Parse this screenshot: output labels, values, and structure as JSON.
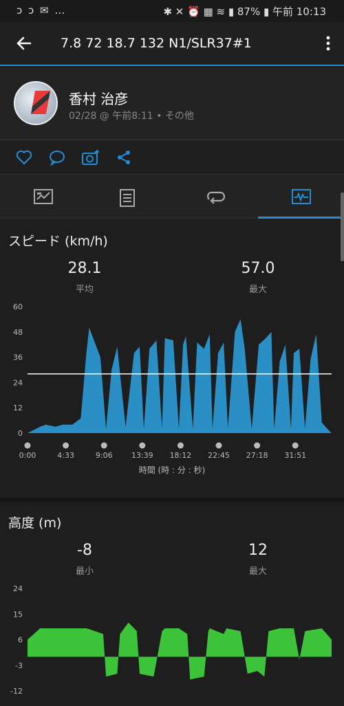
{
  "status": {
    "left_icons": "ↄ ↄ ✉ …",
    "right_text": "✱ ✕ ⏰ ▦ ≋ ▮ 87% ▮ 午前 10:13"
  },
  "appbar": {
    "title": "7.8  72  18.7  132  N1/SLR37#1"
  },
  "profile": {
    "name": "香村 治彦",
    "meta": "02/28 @ 午前8:11 • その他"
  },
  "speed": {
    "title": "スピード (km/h)",
    "avg_value": "28.1",
    "avg_label": "平均",
    "max_value": "57.0",
    "max_label": "最大",
    "x_axis_label": "時間 (時 : 分 : 秒)"
  },
  "altitude": {
    "title": "高度 (m)",
    "min_value": "-8",
    "min_label": "最小",
    "max_value": "12",
    "max_label": "最大"
  },
  "colors": {
    "accent": "#1f8fd8",
    "speed_fill": "#2a8fc4",
    "altitude_fill": "#3ec43a"
  },
  "chart_data": [
    {
      "type": "area",
      "title": "スピード (km/h)",
      "xlabel": "時間 (時 : 分 : 秒)",
      "ylabel": "",
      "ylim": [
        0,
        60
      ],
      "yticks": [
        "60",
        "48",
        "36",
        "24",
        "12",
        "0"
      ],
      "xticks": [
        "0:00",
        "4:33",
        "9:06",
        "13:39",
        "18:12",
        "22:45",
        "27:18",
        "31:51"
      ],
      "xlim": [
        0,
        2170
      ],
      "average_line": 28.1,
      "x": [
        0,
        90,
        130,
        200,
        250,
        320,
        380,
        420,
        440,
        520,
        560,
        600,
        640,
        700,
        760,
        800,
        830,
        870,
        920,
        960,
        980,
        1040,
        1080,
        1110,
        1130,
        1180,
        1210,
        1260,
        1300,
        1320,
        1360,
        1400,
        1430,
        1480,
        1520,
        1550,
        1600,
        1650,
        1700,
        1740,
        1760,
        1800,
        1840,
        1880,
        1900,
        1940,
        1980,
        2020,
        2060,
        2100,
        2140,
        2170
      ],
      "y": [
        0,
        3,
        4,
        3,
        4,
        4,
        7,
        38,
        50,
        36,
        2,
        30,
        41,
        3,
        38,
        41,
        2,
        40,
        44,
        2,
        45,
        44,
        2,
        42,
        46,
        2,
        43,
        40,
        47,
        2,
        38,
        43,
        2,
        48,
        54,
        40,
        2,
        42,
        45,
        48,
        2,
        34,
        42,
        2,
        38,
        40,
        2,
        35,
        47,
        5,
        2,
        0
      ]
    },
    {
      "type": "area",
      "title": "高度 (m)",
      "ylim": [
        -12,
        24
      ],
      "yticks": [
        "24",
        "15",
        "6",
        "-3",
        "-12"
      ],
      "xlim": [
        0,
        2170
      ],
      "x": [
        0,
        90,
        420,
        540,
        560,
        640,
        660,
        720,
        780,
        800,
        900,
        960,
        980,
        1080,
        1140,
        1160,
        1260,
        1290,
        1300,
        1400,
        1420,
        1520,
        1570,
        1640,
        1690,
        1720,
        1800,
        1900,
        1940,
        1980,
        2100,
        2170
      ],
      "y": [
        6,
        10,
        10,
        8,
        -7,
        -6,
        8,
        12,
        9,
        -6,
        -7,
        9,
        10,
        10,
        8,
        -8,
        -7,
        9,
        10,
        8,
        10,
        9,
        -6,
        -5,
        -7,
        9,
        10,
        10,
        -1,
        9,
        10,
        6
      ]
    }
  ]
}
